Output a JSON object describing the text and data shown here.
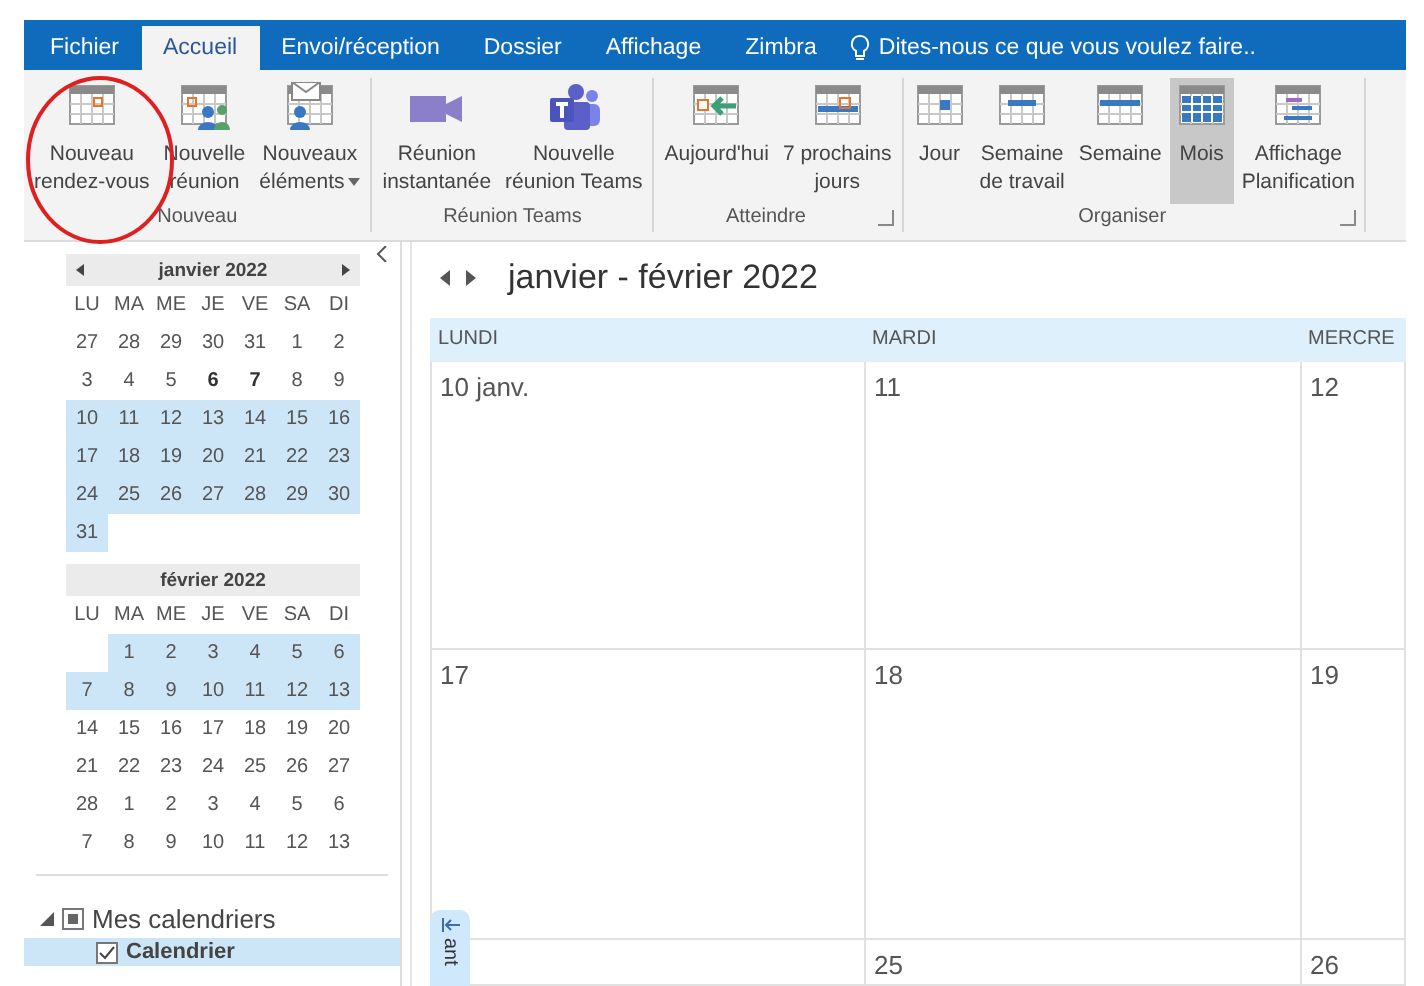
{
  "tabs": [
    {
      "label": "Fichier",
      "selected": false
    },
    {
      "label": "Accueil",
      "selected": true
    },
    {
      "label": "Envoi/réception",
      "selected": false
    },
    {
      "label": "Dossier",
      "selected": false
    },
    {
      "label": "Affichage",
      "selected": false
    },
    {
      "label": "Zimbra",
      "selected": false
    }
  ],
  "tell_me": {
    "label": "Dites-nous ce que vous voulez faire.."
  },
  "ribbon": {
    "groups": [
      {
        "label": "Nouveau",
        "launcher": false,
        "buttons": [
          {
            "label": "Nouveau\nrendez-vous",
            "kind": "calendar",
            "dropdown": false,
            "selected": false
          },
          {
            "label": "Nouvelle\nréunion",
            "kind": "meeting",
            "dropdown": false,
            "selected": false
          },
          {
            "label": "Nouveaux\néléments",
            "kind": "items",
            "dropdown": true,
            "selected": false
          }
        ]
      },
      {
        "label": "Réunion Teams",
        "launcher": false,
        "buttons": [
          {
            "label": "Réunion\ninstantanée",
            "kind": "video",
            "dropdown": false,
            "selected": false
          },
          {
            "label": "Nouvelle\nréunion Teams",
            "kind": "teams",
            "dropdown": false,
            "selected": false
          }
        ]
      },
      {
        "label": "Atteindre",
        "launcher": true,
        "buttons": [
          {
            "label": "Aujourd'hui",
            "kind": "today",
            "dropdown": false,
            "selected": false
          },
          {
            "label": "7 prochains\njours",
            "kind": "next7",
            "dropdown": false,
            "selected": false
          }
        ]
      },
      {
        "label": "Organiser",
        "launcher": true,
        "buttons": [
          {
            "label": "Jour",
            "kind": "day",
            "dropdown": false,
            "selected": false
          },
          {
            "label": "Semaine\nde travail",
            "kind": "workweek",
            "dropdown": false,
            "selected": false
          },
          {
            "label": "Semaine",
            "kind": "week",
            "dropdown": false,
            "selected": false
          },
          {
            "label": "Mois",
            "kind": "month",
            "dropdown": false,
            "selected": true
          },
          {
            "label": "Affichage\nPlanification",
            "kind": "schedule",
            "dropdown": false,
            "selected": false
          }
        ]
      }
    ]
  },
  "mini_calendars": [
    {
      "title": "janvier 2022",
      "arrows": true,
      "weekdays": [
        "LU",
        "MA",
        "ME",
        "JE",
        "VE",
        "SA",
        "DI"
      ],
      "weeks": [
        {
          "selected": false,
          "kind": "full",
          "days": [
            {
              "label": "27",
              "bold": false
            },
            {
              "label": "28",
              "bold": false
            },
            {
              "label": "29",
              "bold": false
            },
            {
              "label": "30",
              "bold": false
            },
            {
              "label": "31",
              "bold": false
            },
            {
              "label": "1",
              "bold": false
            },
            {
              "label": "2",
              "bold": false
            }
          ]
        },
        {
          "selected": false,
          "kind": "full",
          "days": [
            {
              "label": "3",
              "bold": false
            },
            {
              "label": "4",
              "bold": false
            },
            {
              "label": "5",
              "bold": false
            },
            {
              "label": "6",
              "bold": true
            },
            {
              "label": "7",
              "bold": true
            },
            {
              "label": "8",
              "bold": false
            },
            {
              "label": "9",
              "bold": false
            }
          ]
        },
        {
          "selected": true,
          "kind": "full",
          "days": [
            {
              "label": "10",
              "bold": false
            },
            {
              "label": "11",
              "bold": false
            },
            {
              "label": "12",
              "bold": false
            },
            {
              "label": "13",
              "bold": false
            },
            {
              "label": "14",
              "bold": false
            },
            {
              "label": "15",
              "bold": false
            },
            {
              "label": "16",
              "bold": false
            }
          ]
        },
        {
          "selected": true,
          "kind": "full",
          "days": [
            {
              "label": "17",
              "bold": false
            },
            {
              "label": "18",
              "bold": false
            },
            {
              "label": "19",
              "bold": false
            },
            {
              "label": "20",
              "bold": false
            },
            {
              "label": "21",
              "bold": false
            },
            {
              "label": "22",
              "bold": false
            },
            {
              "label": "23",
              "bold": false
            }
          ]
        },
        {
          "selected": true,
          "kind": "full",
          "days": [
            {
              "label": "24",
              "bold": false
            },
            {
              "label": "25",
              "bold": false
            },
            {
              "label": "26",
              "bold": false
            },
            {
              "label": "27",
              "bold": false
            },
            {
              "label": "28",
              "bold": false
            },
            {
              "label": "29",
              "bold": false
            },
            {
              "label": "30",
              "bold": false
            }
          ]
        },
        {
          "selected": true,
          "kind": "tail",
          "days": [
            {
              "label": "31",
              "bold": false
            }
          ]
        }
      ]
    },
    {
      "title": "février 2022",
      "arrows": false,
      "weekdays": [
        "LU",
        "MA",
        "ME",
        "JE",
        "VE",
        "SA",
        "DI"
      ],
      "weeks": [
        {
          "selected": true,
          "kind": "head",
          "days": [
            {
              "label": "1",
              "bold": false
            },
            {
              "label": "2",
              "bold": false
            },
            {
              "label": "3",
              "bold": false
            },
            {
              "label": "4",
              "bold": false
            },
            {
              "label": "5",
              "bold": false
            },
            {
              "label": "6",
              "bold": false
            }
          ]
        },
        {
          "selected": true,
          "kind": "full",
          "days": [
            {
              "label": "7",
              "bold": false
            },
            {
              "label": "8",
              "bold": false
            },
            {
              "label": "9",
              "bold": false
            },
            {
              "label": "10",
              "bold": false
            },
            {
              "label": "11",
              "bold": false
            },
            {
              "label": "12",
              "bold": false
            },
            {
              "label": "13",
              "bold": false
            }
          ]
        },
        {
          "selected": false,
          "kind": "full",
          "days": [
            {
              "label": "14",
              "bold": false
            },
            {
              "label": "15",
              "bold": false
            },
            {
              "label": "16",
              "bold": false
            },
            {
              "label": "17",
              "bold": false
            },
            {
              "label": "18",
              "bold": false
            },
            {
              "label": "19",
              "bold": false
            },
            {
              "label": "20",
              "bold": false
            }
          ]
        },
        {
          "selected": false,
          "kind": "full",
          "days": [
            {
              "label": "21",
              "bold": false
            },
            {
              "label": "22",
              "bold": false
            },
            {
              "label": "23",
              "bold": false
            },
            {
              "label": "24",
              "bold": false
            },
            {
              "label": "25",
              "bold": false
            },
            {
              "label": "26",
              "bold": false
            },
            {
              "label": "27",
              "bold": false
            }
          ]
        },
        {
          "selected": false,
          "kind": "full",
          "days": [
            {
              "label": "28",
              "bold": false
            },
            {
              "label": "1",
              "bold": false
            },
            {
              "label": "2",
              "bold": false
            },
            {
              "label": "3",
              "bold": false
            },
            {
              "label": "4",
              "bold": false
            },
            {
              "label": "5",
              "bold": false
            },
            {
              "label": "6",
              "bold": false
            }
          ]
        },
        {
          "selected": false,
          "kind": "full",
          "days": [
            {
              "label": "7",
              "bold": false
            },
            {
              "label": "8",
              "bold": false
            },
            {
              "label": "9",
              "bold": false
            },
            {
              "label": "10",
              "bold": false
            },
            {
              "label": "11",
              "bold": false
            },
            {
              "label": "12",
              "bold": false
            },
            {
              "label": "13",
              "bold": false
            }
          ]
        }
      ]
    }
  ],
  "folders": [
    {
      "label": "Mes calendriers",
      "expanded": true,
      "indeterminate": true,
      "children": [
        {
          "label": "Calendrier",
          "checked": true,
          "selected": true
        }
      ]
    }
  ],
  "calendar_view": {
    "title": "janvier - février 2022",
    "columns": [
      "LUNDI",
      "MARDI",
      "MERCRE"
    ],
    "weeks": [
      {
        "kind": "full",
        "cells": [
          "10 janv.",
          "11",
          "12"
        ]
      },
      {
        "kind": "full",
        "cells": [
          "17",
          "18",
          "19"
        ]
      },
      {
        "kind": "head",
        "cells": [
          "25",
          "26"
        ]
      }
    ]
  },
  "peek_tab": {
    "label": "ant"
  }
}
